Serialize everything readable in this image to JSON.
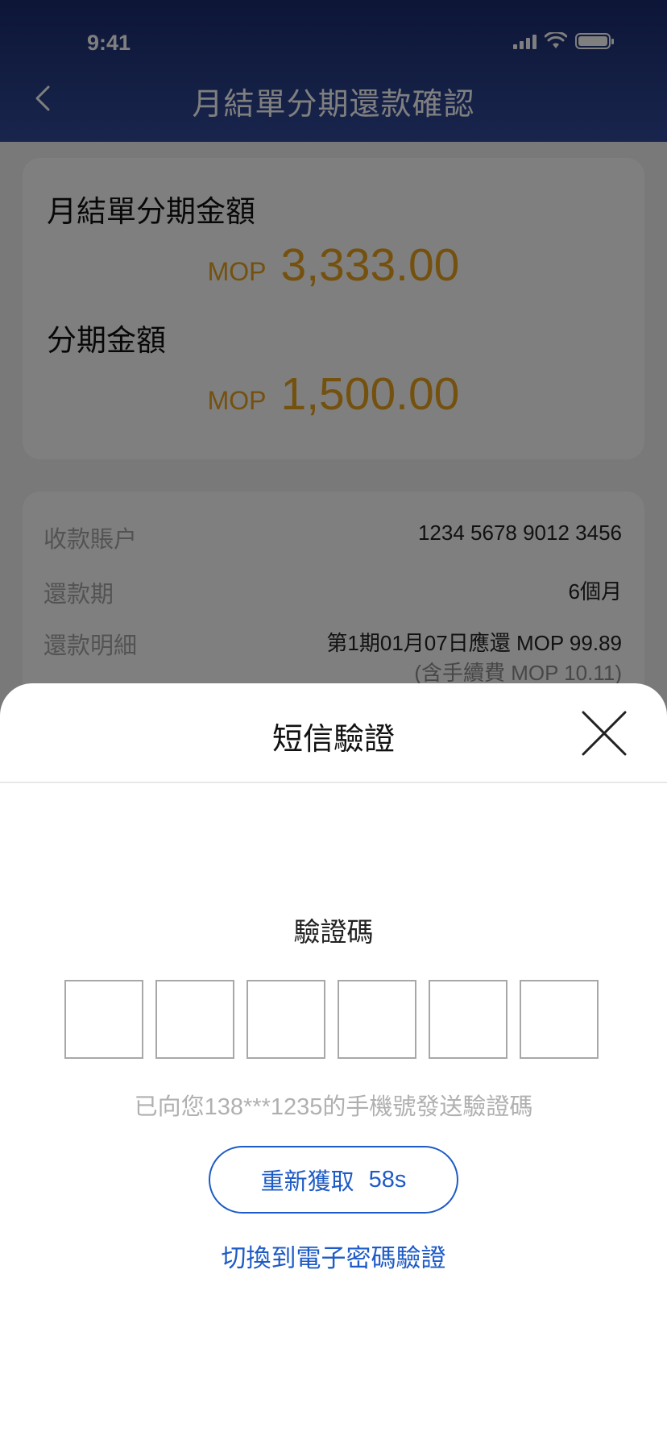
{
  "status_bar": {
    "time": "9:41"
  },
  "header": {
    "title": "月結單分期還款確認"
  },
  "summary": {
    "statement_label": "月結單分期金額",
    "statement_currency": "MOP",
    "statement_amount": "3,333.00",
    "installment_label": "分期金額",
    "installment_currency": "MOP",
    "installment_amount": "1,500.00"
  },
  "details": {
    "rows": [
      {
        "label": "收款賬户",
        "value": "1234 5678 9012 3456"
      },
      {
        "label": "還款期",
        "value": "6個月"
      },
      {
        "label": "還款明細",
        "value": "第1期01月07日應還 MOP 99.89"
      }
    ],
    "fee_note": "(含手續費 MOP 10.11)"
  },
  "sms_sheet": {
    "title": "短信驗證",
    "code_label": "驗證碼",
    "code_digits": [
      "",
      "",
      "",
      "",
      "",
      ""
    ],
    "hint": "已向您138***1235的手機號發送驗證碼",
    "resend_label": "重新獲取",
    "resend_countdown": "58s",
    "switch_label": "切換到電子密碼驗證"
  },
  "colors": {
    "header_top": "#1a2c6e",
    "header_bottom": "#324a9a",
    "amount": "#e8a21c",
    "link": "#1e5bc6"
  }
}
